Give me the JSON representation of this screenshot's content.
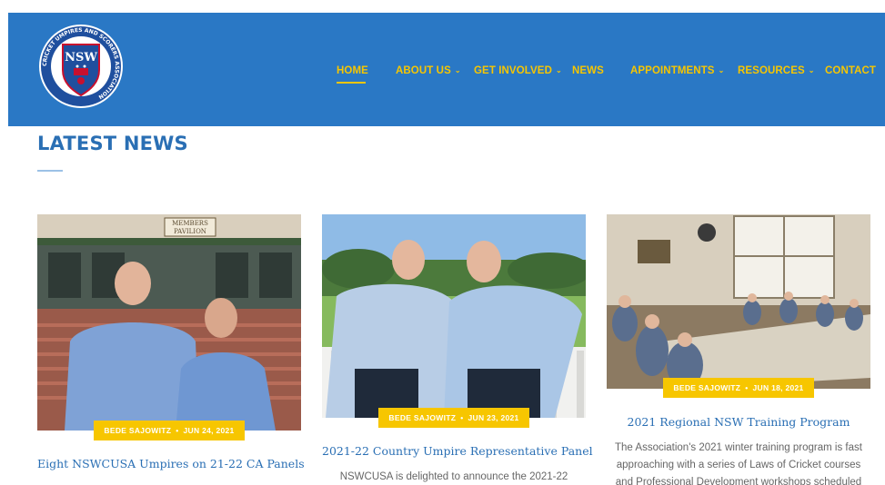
{
  "header": {
    "logo_icon": "association-crest-icon",
    "logo_letters": "NSW",
    "logo_ring_text": "CRICKET UMPIRES AND SCORERS ASSOCIATION",
    "colors": {
      "bar": "#2a78c5",
      "nav_text": "#f7c600"
    }
  },
  "nav": {
    "home": "HOME",
    "about": "ABOUT US",
    "involved": "GET INVOLVED",
    "news": "NEWS",
    "appointments": "APPOINTMENTS",
    "resources": "RESOURCES",
    "contact": "CONTACT",
    "dropdown_icon": "chevron-down-icon"
  },
  "section": {
    "title": "LATEST NEWS"
  },
  "posts": [
    {
      "image_sign_line1": "MEMBERS",
      "image_sign_line2": "PAVILION",
      "author": "BEDE SAJOWITZ",
      "date": "JUN 24, 2021",
      "title": "Eight NSWCUSA Umpires on 21-22 CA Panels"
    },
    {
      "author": "BEDE SAJOWITZ",
      "date": "JUN 23, 2021",
      "title": "2021-22 Country Umpire Representative Panel",
      "excerpt": "NSWCUSA is delighted to announce the 2021-22"
    },
    {
      "author": "BEDE SAJOWITZ",
      "date": "JUN 18, 2021",
      "title": "2021 Regional NSW Training Program",
      "excerpt": "The Association's 2021 winter training program is fast approaching with a series of Laws of Cricket courses and Professional Development workshops scheduled"
    }
  ],
  "badge_separator": "•"
}
